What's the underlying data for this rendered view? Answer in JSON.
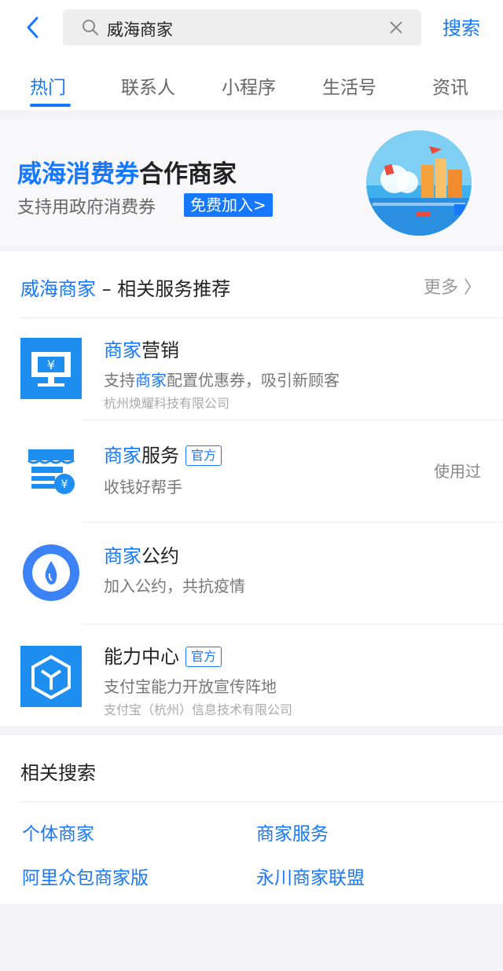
{
  "header": {
    "back_icon": "chevron-left-icon",
    "search_query": "威海商家",
    "search_button": "搜索"
  },
  "tabs": [
    {
      "label": "热门",
      "active": true
    },
    {
      "label": "联系人"
    },
    {
      "label": "小程序"
    },
    {
      "label": "生活号"
    },
    {
      "label": "资讯"
    }
  ],
  "banner": {
    "title_blue": "威海消费券",
    "title_dark": "合作商家",
    "subtitle": "支持用政府消费券",
    "join_button": "免费加入>"
  },
  "services": {
    "head_blue": "威海商家",
    "head_dark": " – 相关服务推荐",
    "more": "更多 〉",
    "items": [
      {
        "title_blue": "商家",
        "title_dark": "营销",
        "desc_pre": "支持",
        "desc_blue": "商家",
        "desc_post": "配置优惠券，吸引新顾客",
        "company": "杭州焕耀科技有限公司",
        "icon": "coupon-screen-icon"
      },
      {
        "title_blue": "商家",
        "title_dark": "服务",
        "tag": "官方",
        "desc": "收钱好帮手",
        "status": "使用过",
        "icon": "store-icon"
      },
      {
        "title_blue": "商家",
        "title_dark": "公约",
        "desc": "加入公约，共抗疫情",
        "icon": "droplet-icon"
      },
      {
        "title": "能力中心",
        "tag": "官方",
        "desc": "支付宝能力开放宣传阵地",
        "company": "支付宝（杭州）信息技术有限公司",
        "icon": "cube-icon"
      }
    ]
  },
  "related": {
    "title": "相关搜索",
    "links": [
      "个体商家",
      "商家服务",
      "阿里众包商家版",
      "永川商家联盟"
    ]
  },
  "colors": {
    "accent": "#1677ff"
  }
}
